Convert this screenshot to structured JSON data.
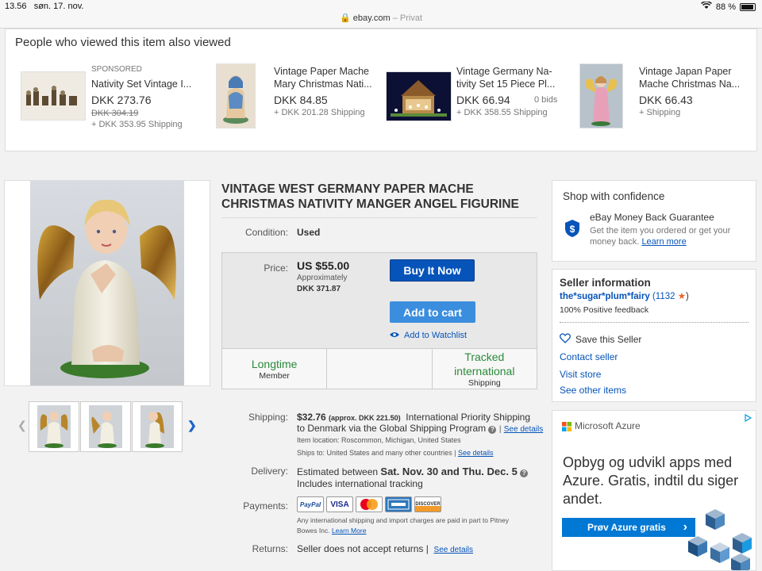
{
  "status_bar": {
    "time": "13.56",
    "date": "søn. 17. nov.",
    "url": "ebay.com",
    "private_label": "– Privat",
    "battery": "88 %",
    "battery_level_percent": 88
  },
  "also_viewed": {
    "title": "People who viewed this item also viewed",
    "items": [
      {
        "sponsored": "SPONSORED",
        "title": "Nativity Set Vintage I...",
        "price": "DKK 273.76",
        "old_price": "DKK 304.19",
        "shipping": "+ DKK 353.95 Shipping",
        "bids": ""
      },
      {
        "sponsored": "",
        "title_line1": "Vintage Paper Mache",
        "title_line2": "Mary Christmas Nati...",
        "price": "DKK 84.85",
        "shipping": "+ DKK 201.28 Shipping",
        "bids": ""
      },
      {
        "sponsored": "",
        "title_line1": "Vintage Germany Na-",
        "title_line2": "tivity Set 15 Piece Pl...",
        "price": "DKK 66.94",
        "shipping": "+ DKK 358.55 Shipping",
        "bids": "0 bids"
      },
      {
        "sponsored": "",
        "title_line1": "Vintage Japan Paper",
        "title_line2": "Mache Christmas Na...",
        "price": "DKK 66.43",
        "shipping": "+ Shipping",
        "bids": ""
      }
    ]
  },
  "item": {
    "title_line1": "VINTAGE WEST GERMANY PAPER MACHE",
    "title_line2": "CHRISTMAS NATIVITY MANGER ANGEL FIGURINE",
    "condition_label": "Condition:",
    "condition_value": "Used",
    "price_label": "Price:",
    "price": "US $55.00",
    "approx_label": "Approximately",
    "price_dkk": "DKK 371.87",
    "buy_now": "Buy It Now",
    "add_to_cart": "Add to cart",
    "watchlist": "Add to Watchlist",
    "badges": [
      {
        "main": "Longtime",
        "sub": "Member"
      },
      {
        "main": "",
        "sub": ""
      },
      {
        "main": "Tracked international",
        "sub": "Shipping"
      }
    ],
    "shipping_label": "Shipping:",
    "shipping_price": "$32.76",
    "shipping_approx": "(approx. DKK 221.50)",
    "shipping_method": "International Priority Shipping",
    "shipping_dest": "to Denmark  via the Global Shipping Program",
    "see_details": "See details",
    "item_location": "Item location:  Roscommon, Michigan, United States",
    "ships_to": "Ships to:  United States and many other countries",
    "delivery_label": "Delivery:",
    "delivery_text": "Estimated between",
    "delivery_dates": "Sat. Nov. 30 and Thu. Dec. 5",
    "delivery_tracking": "Includes international tracking",
    "payments_label": "Payments:",
    "payment_cards": [
      "PayPal",
      "VISA",
      "MasterCard",
      "AMEX",
      "DISCOVER"
    ],
    "payments_note_line1": "Any international shipping and import charges are paid in part to Pitney",
    "payments_note_line2": "Bowes Inc.",
    "learn_more": "Learn More",
    "returns_label": "Returns:",
    "returns_value": "Seller does not accept returns",
    "returns_details": "See details"
  },
  "confidence": {
    "title": "Shop with confidence",
    "guarantee_title": "eBay Money Back Guarantee",
    "guarantee_line1": "Get the item you ordered or get your",
    "guarantee_line2": "money back.",
    "learn_more": "Learn more"
  },
  "seller": {
    "title": "Seller information",
    "name": "the*sugar*plum*fairy",
    "feedback_count": "(1132",
    "close_paren": ")",
    "positive": "100% Positive feedback",
    "save": "Save this Seller",
    "contact": "Contact seller",
    "visit": "Visit store",
    "other": "See other items"
  },
  "ad": {
    "brand": "Microsoft Azure",
    "headline_line1": "Opbyg og udvikl apps med",
    "headline_line2": "Azure. Gratis, indtil du siger",
    "headline_line3": "andet.",
    "cta": "Prøv Azure gratis",
    "cta_arrow": "›",
    "brand_color": "#0078d4"
  },
  "colors": {
    "ebay_blue": "#0654ba",
    "cart_blue": "#3b8ede",
    "green": "#2a8a3a",
    "star": "#e8642b"
  }
}
